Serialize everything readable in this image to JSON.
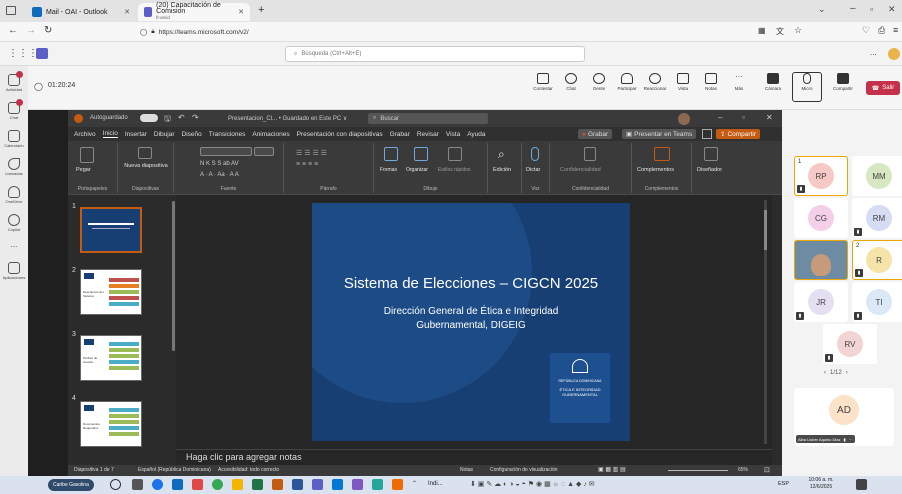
{
  "browser": {
    "tabs": [
      {
        "label": "Mail - OAI - Outlook"
      },
      {
        "label": "(20) Capacitación de Comision",
        "sub": "ft-amid"
      }
    ],
    "new_tab": "+",
    "url": "https://teams.microsoft.com/v2/"
  },
  "teams": {
    "search_placeholder": "Búsqueda (Ctrl+Alt+E)",
    "more": "...",
    "rail": [
      {
        "label": "Actividad"
      },
      {
        "label": "Chat"
      },
      {
        "label": "Calendario"
      },
      {
        "label": "Llamadas"
      },
      {
        "label": "OneDrive"
      },
      {
        "label": "Copilot"
      },
      {
        "label": "..."
      },
      {
        "label": "Aplicaciones"
      }
    ]
  },
  "meeting": {
    "timer": "01:20:24",
    "controls": [
      {
        "label": "Contestar"
      },
      {
        "label": "Chat"
      },
      {
        "label": "Gente"
      },
      {
        "label": "Participar"
      },
      {
        "label": "Reaccionar"
      },
      {
        "label": "Vista"
      },
      {
        "label": "Notas"
      },
      {
        "label": "Más"
      },
      {
        "label": "Cámara"
      },
      {
        "label": "Micro"
      },
      {
        "label": "Compartir"
      }
    ],
    "leave_label": "Salir"
  },
  "ppt": {
    "autosave": "Autoguardado",
    "doc_title": "Presentacion_Cl... • Guardado en Este PC ∨",
    "search": "Buscar",
    "menu": [
      "Archivo",
      "Inicio",
      "Insertar",
      "Dibujar",
      "Diseño",
      "Transiciones",
      "Animaciones",
      "Presentación con diapositivas",
      "Grabar",
      "Revisar",
      "Vista",
      "Ayuda"
    ],
    "record_btn": "Grabar",
    "present_btn": "Presentar en Teams",
    "share_btn": "Compartir",
    "ribbon_groups": [
      "Portapapeles",
      "Diapositivas",
      "Fuente",
      "Párrafo",
      "Dibujo",
      "Voz",
      "Confidencialidad",
      "Complementos"
    ],
    "ribbon_buttons": {
      "paste": "Pegar",
      "new_slide": "Nueva diapositiva",
      "font_row": "N  K  S  S  ab  AV",
      "shapes": "Formas",
      "arrange": "Organizar",
      "quick_styles": "Estilos rápidos",
      "editing": "Edición",
      "dictate": "Dictar",
      "sensitivity": "Confidencialidad",
      "addins": "Complementos",
      "designer": "Diseñador"
    },
    "thumbnails": [
      {
        "num": "1"
      },
      {
        "num": "2",
        "label": "Descripción del Sistema"
      },
      {
        "num": "3",
        "label": "Perfiles de Usuario"
      },
      {
        "num": "4",
        "label": "Documentos Requeridos"
      }
    ],
    "slide": {
      "title": "Sistema de Elecciones – CIGCN 2025",
      "subtitle_1": "Dirección General de Ética e Integridad",
      "subtitle_2": "Gubernamental, DIGEIG",
      "logo_1": "REPÚBLICA DOMINICANA",
      "logo_2": "ÉTICA E INTEGRIDAD",
      "logo_3": "GUBERNAMENTAL"
    },
    "notes_placeholder": "Haga clic para agregar notas",
    "status": {
      "slide_count": "Diapositiva 1 de 7",
      "language": "Español (República Dominicana)",
      "accessibility": "Accesibilidad: todo correcto",
      "notes": "Notas",
      "view_settings": "Configuración de visualización",
      "zoom": "65%"
    }
  },
  "participants": [
    {
      "initials": "RP",
      "badge": "1"
    },
    {
      "initials": "MM"
    },
    {
      "initials": "CG"
    },
    {
      "initials": "RM"
    },
    {
      "initials": "R",
      "badge": "2"
    },
    {
      "initials": "JR"
    },
    {
      "initials": "TI"
    },
    {
      "initials": "RV"
    },
    {
      "initials": "AD",
      "name": "Alba Lisber Aquino Diaz"
    }
  ],
  "pager": "1/12",
  "taskbar": {
    "search": "Caribe Gasolina",
    "app_label": "Indi...",
    "lang": "ESP",
    "time": "10:06 a. m.",
    "date": "12/6/2025"
  },
  "colors": {
    "slide_bg": "#173f74",
    "leave": "#c4314b",
    "share_orange": "#c55a11"
  }
}
